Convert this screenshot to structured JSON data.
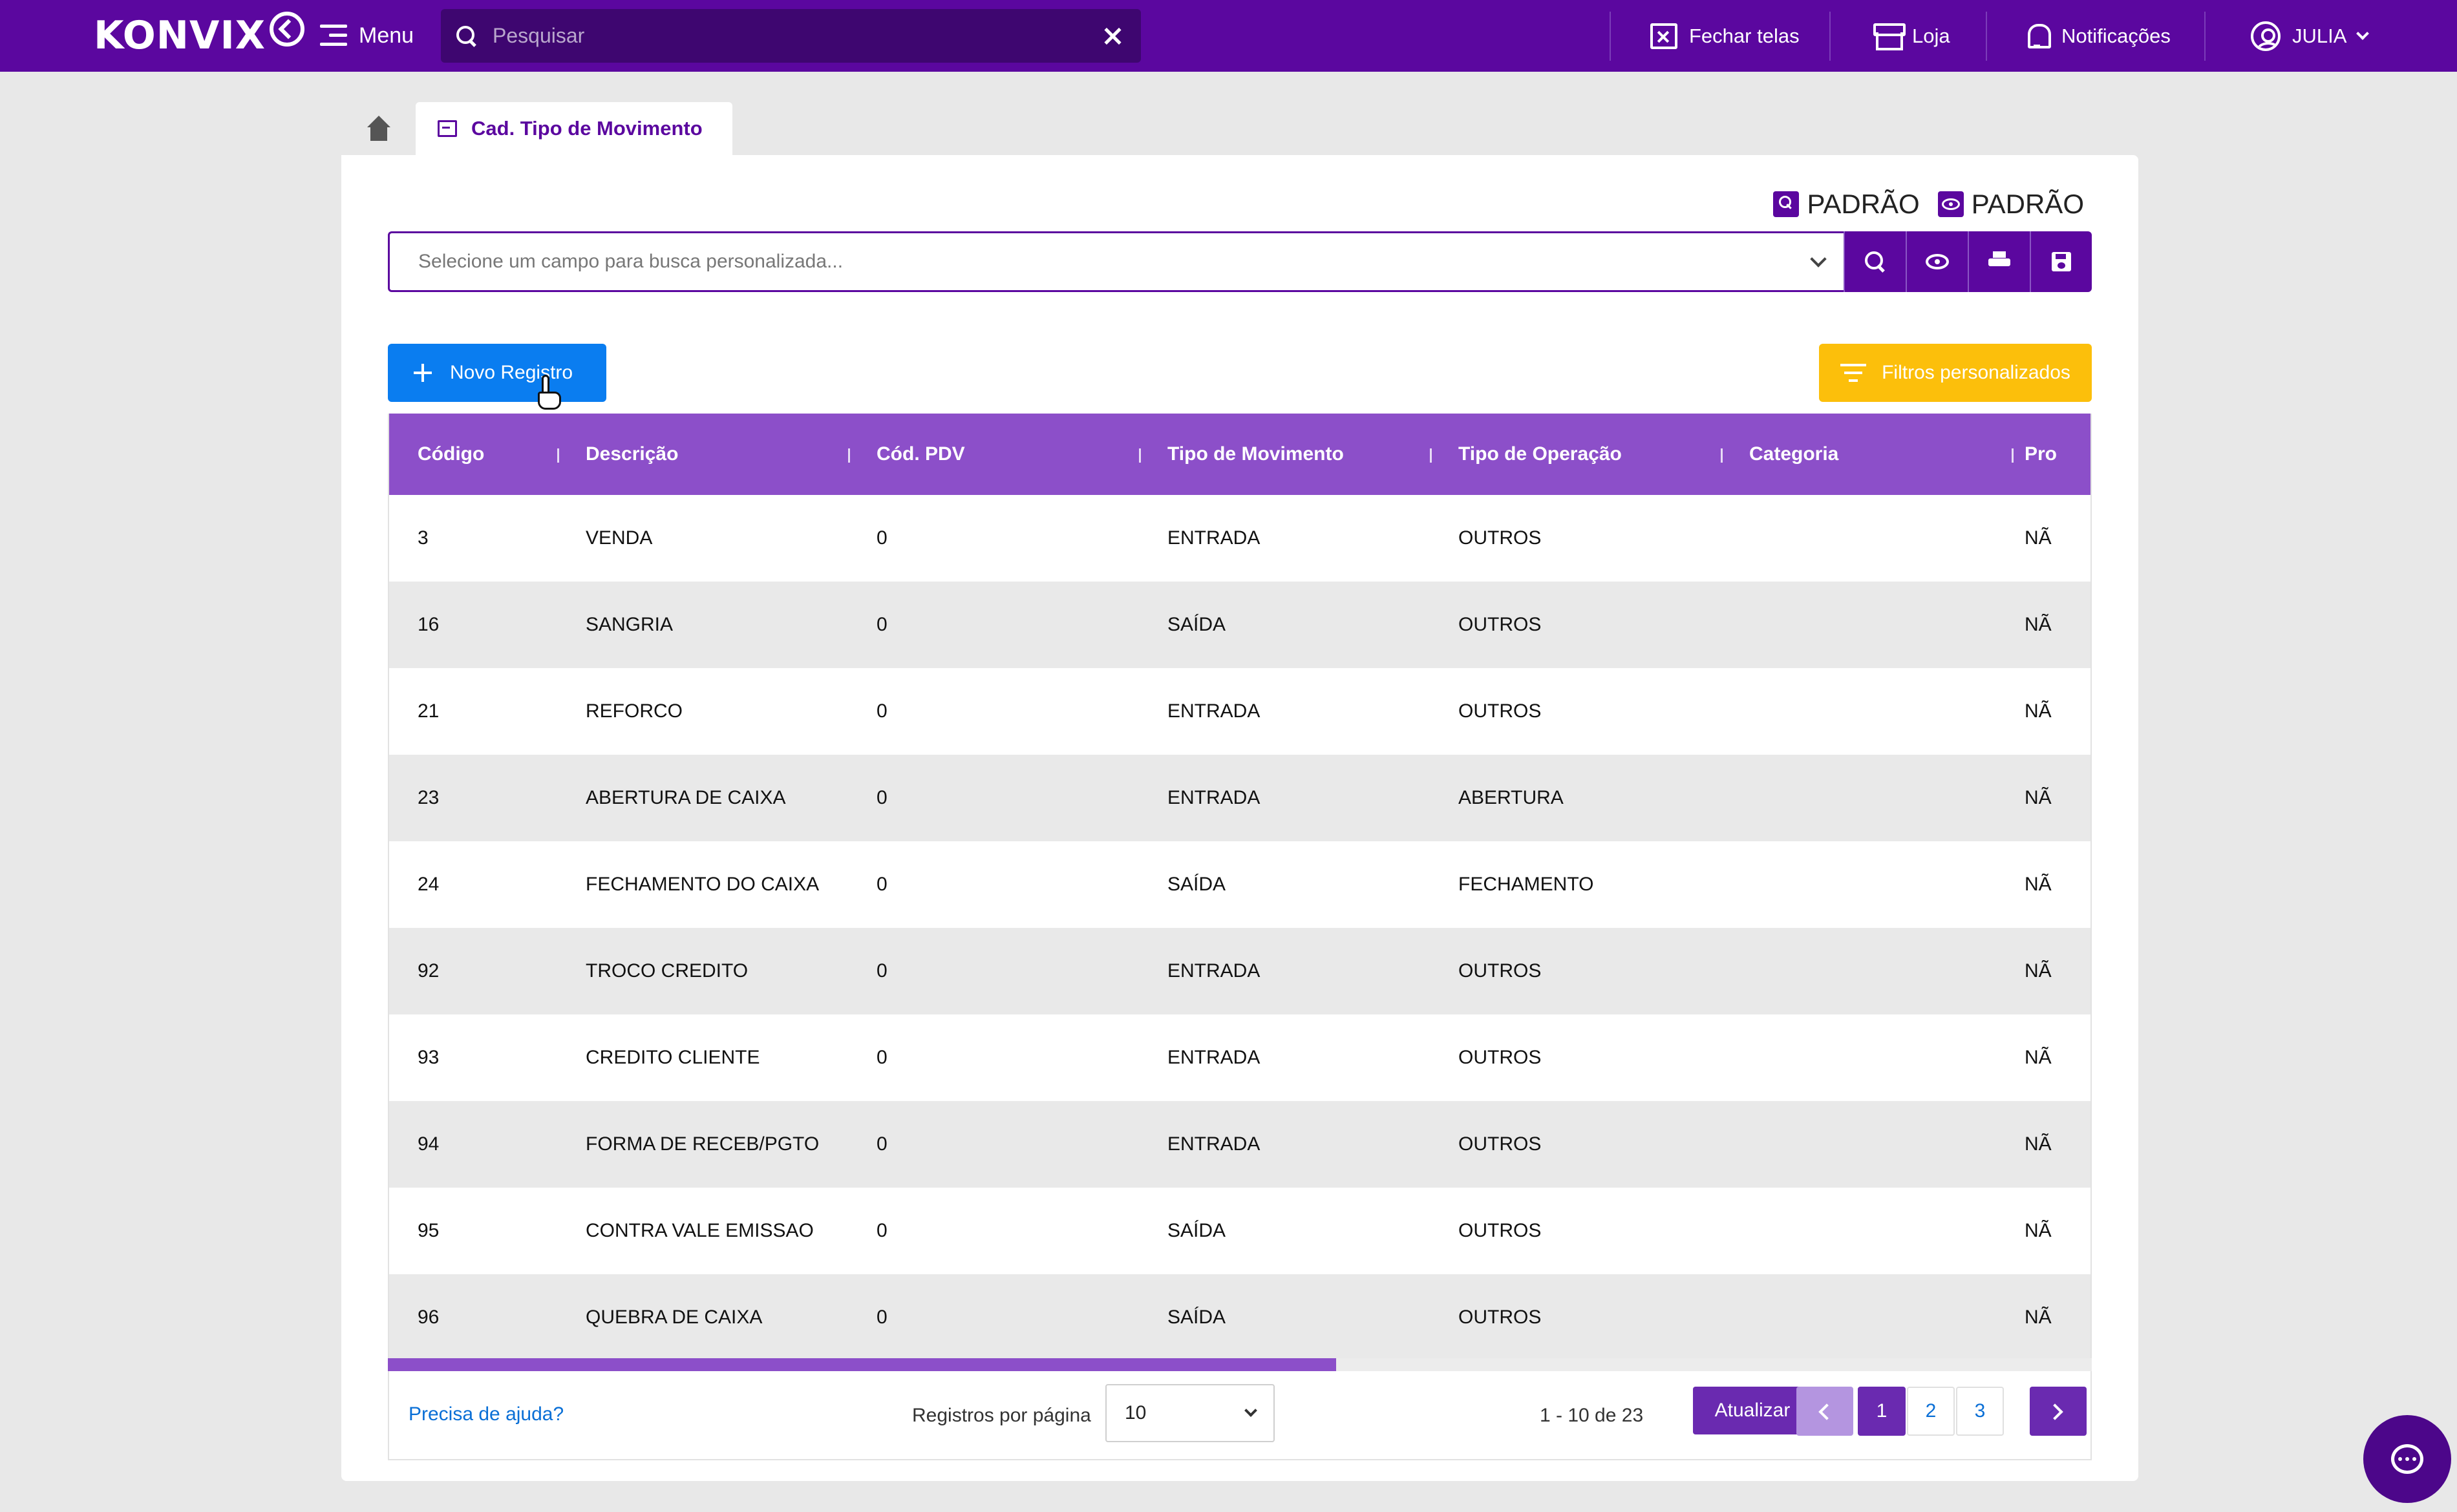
{
  "topbar": {
    "logo": "KONVIX",
    "menu_label": "Menu",
    "search_placeholder": "Pesquisar",
    "items": [
      {
        "label": "Fechar telas",
        "icon": "close-window-icon"
      },
      {
        "label": "Loja",
        "icon": "store-icon"
      },
      {
        "label": "Notificações",
        "icon": "bell-icon"
      },
      {
        "label": "JULIA",
        "icon": "user-circle-icon"
      }
    ],
    "colors": {
      "bar": "#5b079f",
      "search": "#3e0670"
    }
  },
  "tabs": {
    "home_icon": "home-icon",
    "active_label": "Cad. Tipo de Movimento"
  },
  "toolbar": {
    "padrao_search": "PADRÃO",
    "padrao_view": "PADRÃO",
    "custom_search_placeholder": "Selecione um campo para busca personalizada...",
    "new_record": "Novo Registro",
    "custom_filters": "Filtros personalizados",
    "colors": {
      "primary": "#5b079f",
      "new": "#0a7df0",
      "filters": "#fcbf0b"
    }
  },
  "table": {
    "columns": [
      "Código",
      "Descrição",
      "Cód. PDV",
      "Tipo de Movimento",
      "Tipo de Operação",
      "Categoria",
      "Pro"
    ],
    "rows": [
      [
        "3",
        "VENDA",
        "0",
        "ENTRADA",
        "OUTROS",
        "",
        "NÃ"
      ],
      [
        "16",
        "SANGRIA",
        "0",
        "SAÍDA",
        "OUTROS",
        "",
        "NÃ"
      ],
      [
        "21",
        "REFORCO",
        "0",
        "ENTRADA",
        "OUTROS",
        "",
        "NÃ"
      ],
      [
        "23",
        "ABERTURA DE CAIXA",
        "0",
        "ENTRADA",
        "ABERTURA",
        "",
        "NÃ"
      ],
      [
        "24",
        "FECHAMENTO DO CAIXA",
        "0",
        "SAÍDA",
        "FECHAMENTO",
        "",
        "NÃ"
      ],
      [
        "92",
        "TROCO CREDITO",
        "0",
        "ENTRADA",
        "OUTROS",
        "",
        "NÃ"
      ],
      [
        "93",
        "CREDITO CLIENTE",
        "0",
        "ENTRADA",
        "OUTROS",
        "",
        "NÃ"
      ],
      [
        "94",
        "FORMA DE RECEB/PGTO",
        "0",
        "ENTRADA",
        "OUTROS",
        "",
        "NÃ"
      ],
      [
        "95",
        "CONTRA VALE EMISSAO",
        "0",
        "SAÍDA",
        "OUTROS",
        "",
        "NÃ"
      ],
      [
        "96",
        "QUEBRA DE CAIXA",
        "0",
        "SAÍDA",
        "OUTROS",
        "",
        "NÃ"
      ]
    ],
    "header_color": "#8c4fc9"
  },
  "footer": {
    "help": "Precisa de ajuda?",
    "rows_per_page_label": "Registros por página",
    "rows_per_page_value": "10",
    "range": "1 - 10 de 23",
    "refresh": "Atualizar",
    "pages": [
      "1",
      "2",
      "3"
    ],
    "active_page": "1"
  },
  "chat": {
    "icon": "chat-bubble-icon"
  }
}
